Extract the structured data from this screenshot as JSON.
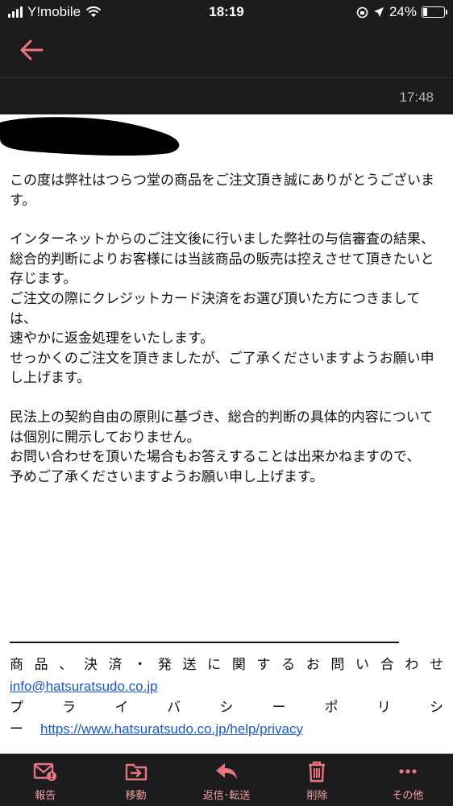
{
  "status_bar": {
    "carrier": "Y!mobile",
    "time": "18:19",
    "battery": "24%"
  },
  "mail": {
    "received_time": "17:48",
    "paragraphs": [
      [
        "この度は弊社はつらつ堂の商品をご注文頂き誠にありがとうございます。"
      ],
      [
        "インターネットからのご注文後に行いました弊社の与信審査の結果、",
        "総合的判断によりお客様には当該商品の販売は控えさせて頂きたいと存じます。",
        "ご注文の際にクレジットカード決済をお選び頂いた方につきましては、",
        "速やかに返金処理をいたします。",
        "せっかくのご注文を頂きましたが、ご了承くださいますようお願い申し上げます。"
      ],
      [
        "民法上の契約自由の原則に基づき、総合的判断の具体的内容については個別に開示しておりません。",
        "お問い合わせを頂いた場合もお答えすることは出来かねますので、",
        "予めご了承くださいますようお願い申し上げます。"
      ]
    ],
    "footer": {
      "inquiry_line": "商品、決済・発送に関するお問い合わせ",
      "email": "info@hatsuratsudo.co.jp",
      "privacy_line": "プライバシーポリシ",
      "privacy_dash": "ー",
      "privacy_url": "https://www.hatsuratsudo.co.jp/help/privacy"
    }
  },
  "toolbar": {
    "items": [
      {
        "label": "報告",
        "icon": "report-mail-icon"
      },
      {
        "label": "移動",
        "icon": "move-folder-icon"
      },
      {
        "label": "返信･転送",
        "icon": "reply-icon"
      },
      {
        "label": "削除",
        "icon": "trash-icon"
      },
      {
        "label": "その他",
        "icon": "more-icon"
      }
    ]
  },
  "colors": {
    "bar_bg": "#1c1c1e",
    "accent": "#e8747c",
    "link": "#1a57c9"
  }
}
